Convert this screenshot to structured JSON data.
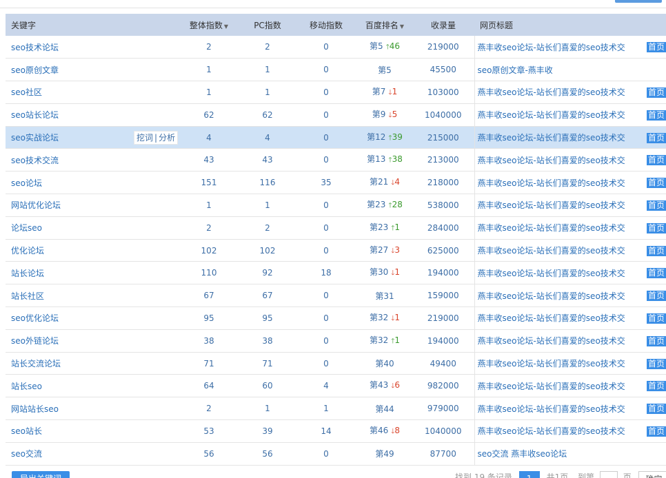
{
  "headers": {
    "keyword": "关键字",
    "overall": "整体指数",
    "pc": "PC指数",
    "mobile": "移动指数",
    "rank": "百度排名",
    "indexed": "收录量",
    "title": "网页标题"
  },
  "hover_actions": {
    "mine": "挖词",
    "analyze": "分析"
  },
  "home_badge": "首页",
  "rows": [
    {
      "kw": "seo技术论坛",
      "overall": "2",
      "pc": "2",
      "mobile": "0",
      "rank": "第5",
      "change": "46",
      "dir": "up",
      "indexed": "219000",
      "title": "燕丰收seo论坛-站长们喜爱的seo技术交",
      "home": true
    },
    {
      "kw": "seo原创文章",
      "overall": "1",
      "pc": "1",
      "mobile": "0",
      "rank": "第5",
      "change": "",
      "dir": "",
      "indexed": "45500",
      "title": "seo原创文章-燕丰收",
      "home": false
    },
    {
      "kw": "seo社区",
      "overall": "1",
      "pc": "1",
      "mobile": "0",
      "rank": "第7",
      "change": "1",
      "dir": "down",
      "indexed": "103000",
      "title": "燕丰收seo论坛-站长们喜爱的seo技术交",
      "home": true
    },
    {
      "kw": "seo站长论坛",
      "overall": "62",
      "pc": "62",
      "mobile": "0",
      "rank": "第9",
      "change": "5",
      "dir": "down",
      "indexed": "1040000",
      "title": "燕丰收seo论坛-站长们喜爱的seo技术交",
      "home": true
    },
    {
      "kw": "seo实战论坛",
      "overall": "4",
      "pc": "4",
      "mobile": "0",
      "rank": "第12",
      "change": "39",
      "dir": "up",
      "indexed": "215000",
      "title": "燕丰收seo论坛-站长们喜爱的seo技术交",
      "home": true,
      "highlight": true
    },
    {
      "kw": "seo技术交流",
      "overall": "43",
      "pc": "43",
      "mobile": "0",
      "rank": "第13",
      "change": "38",
      "dir": "up",
      "indexed": "213000",
      "title": "燕丰收seo论坛-站长们喜爱的seo技术交",
      "home": true
    },
    {
      "kw": "seo论坛",
      "overall": "151",
      "pc": "116",
      "mobile": "35",
      "rank": "第21",
      "change": "4",
      "dir": "down",
      "indexed": "218000",
      "title": "燕丰收seo论坛-站长们喜爱的seo技术交",
      "home": true
    },
    {
      "kw": "网站优化论坛",
      "overall": "1",
      "pc": "1",
      "mobile": "0",
      "rank": "第23",
      "change": "28",
      "dir": "up",
      "indexed": "538000",
      "title": "燕丰收seo论坛-站长们喜爱的seo技术交",
      "home": true
    },
    {
      "kw": "论坛seo",
      "overall": "2",
      "pc": "2",
      "mobile": "0",
      "rank": "第23",
      "change": "1",
      "dir": "up",
      "indexed": "284000",
      "title": "燕丰收seo论坛-站长们喜爱的seo技术交",
      "home": true
    },
    {
      "kw": "优化论坛",
      "overall": "102",
      "pc": "102",
      "mobile": "0",
      "rank": "第27",
      "change": "3",
      "dir": "down",
      "indexed": "625000",
      "title": "燕丰收seo论坛-站长们喜爱的seo技术交",
      "home": true
    },
    {
      "kw": "站长论坛",
      "overall": "110",
      "pc": "92",
      "mobile": "18",
      "rank": "第30",
      "change": "1",
      "dir": "down",
      "indexed": "194000",
      "title": "燕丰收seo论坛-站长们喜爱的seo技术交",
      "home": true
    },
    {
      "kw": "站长社区",
      "overall": "67",
      "pc": "67",
      "mobile": "0",
      "rank": "第31",
      "change": "",
      "dir": "",
      "indexed": "159000",
      "title": "燕丰收seo论坛-站长们喜爱的seo技术交",
      "home": true
    },
    {
      "kw": "seo优化论坛",
      "overall": "95",
      "pc": "95",
      "mobile": "0",
      "rank": "第32",
      "change": "1",
      "dir": "down",
      "indexed": "219000",
      "title": "燕丰收seo论坛-站长们喜爱的seo技术交",
      "home": true
    },
    {
      "kw": "seo外链论坛",
      "overall": "38",
      "pc": "38",
      "mobile": "0",
      "rank": "第32",
      "change": "1",
      "dir": "up",
      "indexed": "194000",
      "title": "燕丰收seo论坛-站长们喜爱的seo技术交",
      "home": true
    },
    {
      "kw": "站长交流论坛",
      "overall": "71",
      "pc": "71",
      "mobile": "0",
      "rank": "第40",
      "change": "",
      "dir": "",
      "indexed": "49400",
      "title": "燕丰收seo论坛-站长们喜爱的seo技术交",
      "home": true
    },
    {
      "kw": "站长seo",
      "overall": "64",
      "pc": "60",
      "mobile": "4",
      "rank": "第43",
      "change": "6",
      "dir": "down",
      "indexed": "982000",
      "title": "燕丰收seo论坛-站长们喜爱的seo技术交",
      "home": true
    },
    {
      "kw": "网站站长seo",
      "overall": "2",
      "pc": "1",
      "mobile": "1",
      "rank": "第44",
      "change": "",
      "dir": "",
      "indexed": "979000",
      "title": "燕丰收seo论坛-站长们喜爱的seo技术交",
      "home": true
    },
    {
      "kw": "seo站长",
      "overall": "53",
      "pc": "39",
      "mobile": "14",
      "rank": "第46",
      "change": "8",
      "dir": "down",
      "indexed": "1040000",
      "title": "燕丰收seo论坛-站长们喜爱的seo技术交",
      "home": true
    },
    {
      "kw": "seo交流",
      "overall": "56",
      "pc": "56",
      "mobile": "0",
      "rank": "第49",
      "change": "",
      "dir": "",
      "indexed": "87700",
      "title": "seo交流 燕丰收seo论坛",
      "home": false
    }
  ],
  "footer": {
    "export_label": "导出关键词",
    "found_text": "找到 19 条记录",
    "current_page": "1",
    "total_pages": "共1页",
    "goto_label": "到第",
    "page_unit": "页",
    "confirm_label": "确定"
  },
  "colors": {
    "header_bg": "#c9d6ea",
    "highlight_bg": "#cfe2f6",
    "accent": "#3a8ee6",
    "up": "#3b9a2e",
    "down": "#d9442b"
  }
}
